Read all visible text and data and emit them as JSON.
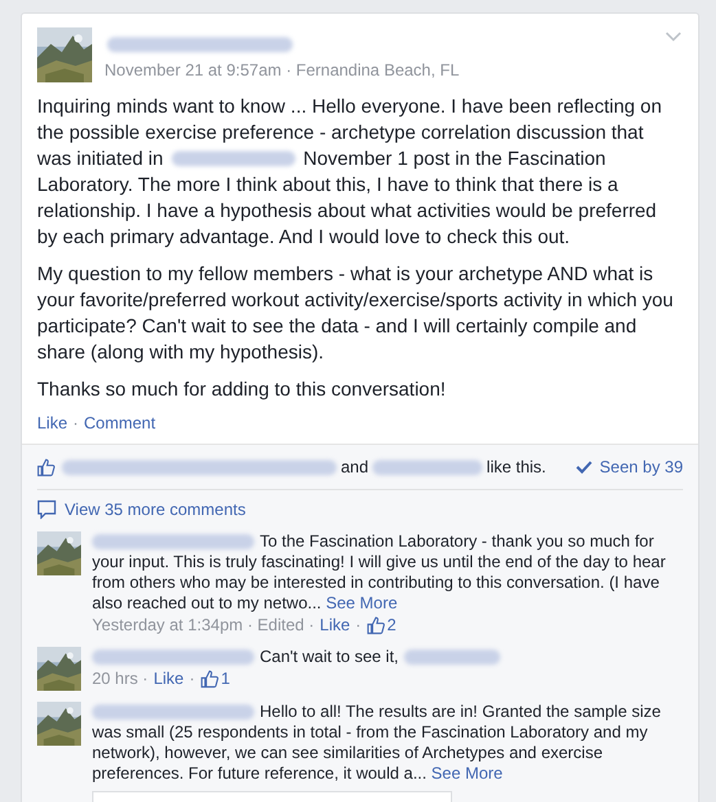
{
  "post": {
    "meta": "November 21 at 9:57am · Fernandina Beach, FL",
    "paragraphs": [
      [
        {
          "kind": "text",
          "text": "Inquiring minds want to know ... Hello everyone. I have been reflecting on the possible exercise preference - archetype correlation discussion that was initiated in"
        },
        {
          "kind": "redacted"
        },
        {
          "kind": "text",
          "text": "November 1 post in the Fascination Laboratory. The more I think about this, I have to think that there is a relationship. I have a hypothesis about what activities would be preferred by each primary advantage. And I would love to check this out."
        }
      ],
      [
        {
          "kind": "text",
          "text": "My question to my fellow members - what is your archetype AND what is your favorite/preferred workout activity/exercise/sports activity in which you participate? Can't wait to see the data - and I will certainly compile and share (along with my hypothesis)."
        }
      ],
      [
        {
          "kind": "text",
          "text": "Thanks so much for adding to this conversation!"
        }
      ]
    ],
    "actions": [
      {
        "kind": "link",
        "text": "Like"
      },
      {
        "kind": "text",
        "text": "·"
      },
      {
        "kind": "link",
        "text": "Comment"
      }
    ]
  },
  "likes": {
    "parts": [
      {
        "kind": "redacted"
      },
      {
        "kind": "text",
        "text": "and"
      },
      {
        "kind": "redacted"
      },
      {
        "kind": "text",
        "text": "like this."
      }
    ],
    "seen": "Seen by 39"
  },
  "view_more": "View 35 more comments",
  "comments": [
    {
      "head": [
        {
          "kind": "redacted"
        },
        {
          "kind": "text",
          "text": "To the Fascination Laboratory - thank you so much for"
        }
      ],
      "parts": [
        {
          "kind": "text",
          "text": "your input. This is truly fascinating! I will give us until the end of the day to hear from others who may be interested in contributing to this conversation. (I have also reached out to my netwo..."
        },
        {
          "kind": "link",
          "text": "See More"
        }
      ],
      "meta": [
        {
          "kind": "text",
          "text": "Yesterday at 1:34pm · Edited ·"
        },
        {
          "kind": "link",
          "text": "Like"
        },
        {
          "kind": "text",
          "text": "·"
        },
        {
          "kind": "likes",
          "text": "2"
        }
      ]
    },
    {
      "head": [
        {
          "kind": "redacted"
        },
        {
          "kind": "text",
          "text": "Can't wait to see it,"
        },
        {
          "kind": "redacted"
        }
      ],
      "meta": [
        {
          "kind": "text",
          "text": "20 hrs ·"
        },
        {
          "kind": "link",
          "text": "Like"
        },
        {
          "kind": "text",
          "text": "·"
        },
        {
          "kind": "likes",
          "text": "1"
        }
      ]
    },
    {
      "head": [
        {
          "kind": "redacted"
        },
        {
          "kind": "text",
          "text": "Hello to all! The results are in! Granted the sample size"
        }
      ],
      "parts": [
        {
          "kind": "text",
          "text": "was small (25 respondents in total - from the Fascination Laboratory and my network), however, we can see similarities of Archetypes and exercise preferences. For future reference, it would a..."
        },
        {
          "kind": "link",
          "text": "See More"
        }
      ],
      "attachment": {
        "kind": "picture"
      }
    }
  ]
}
